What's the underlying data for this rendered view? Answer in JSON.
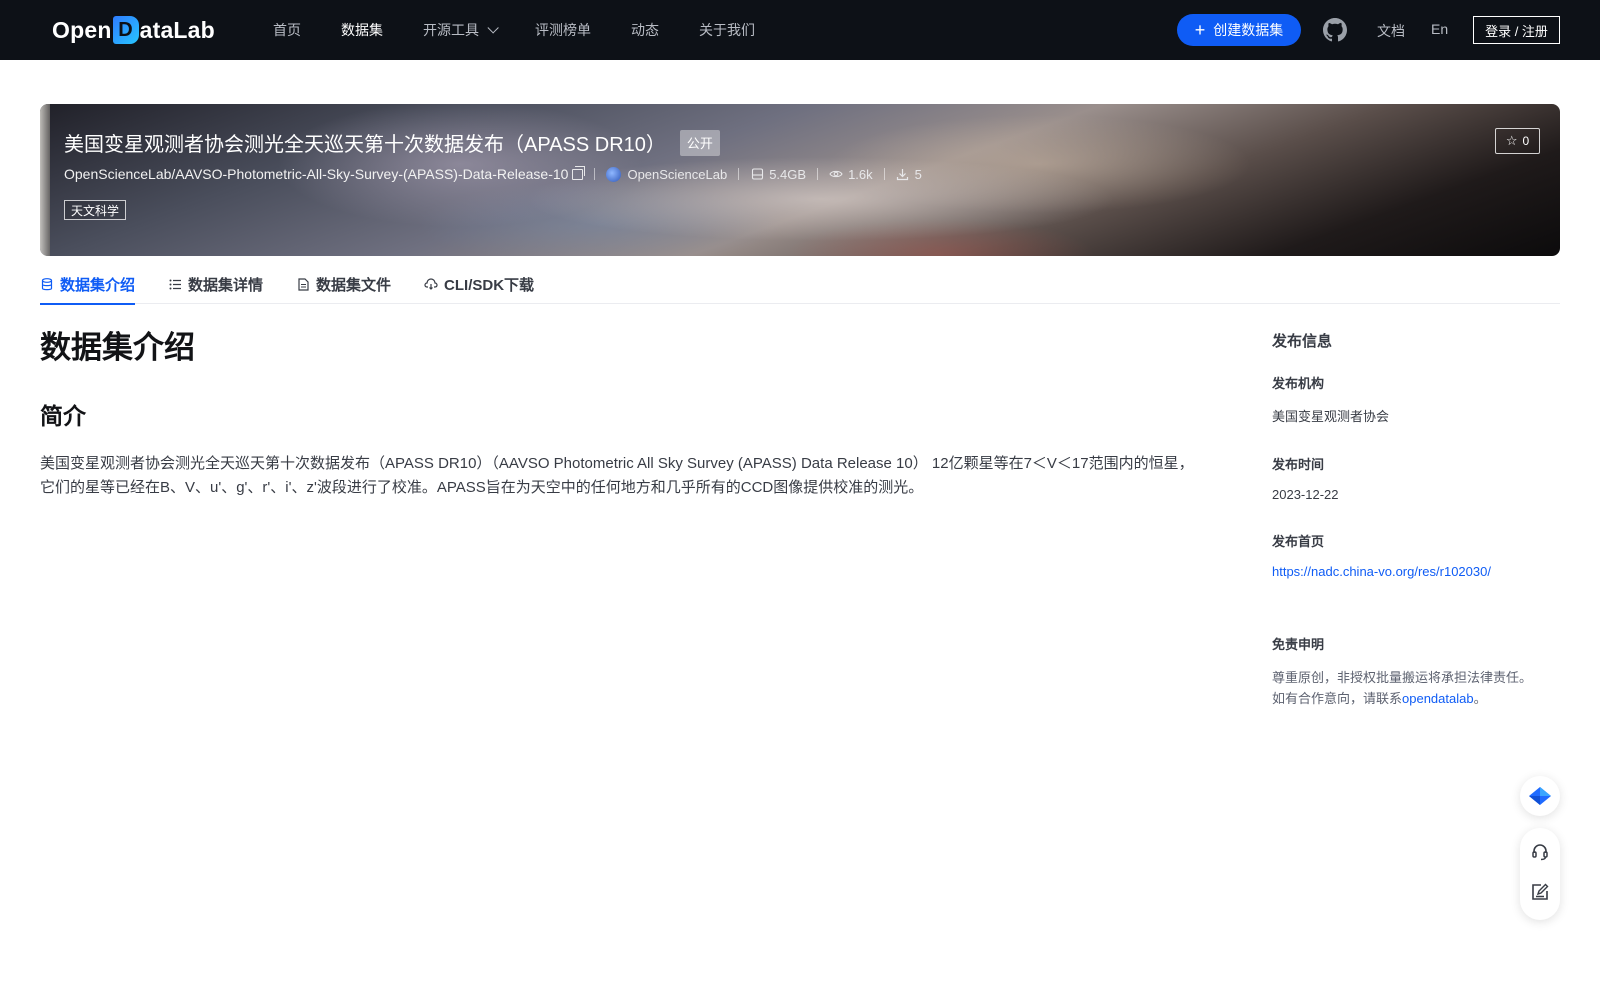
{
  "nav": {
    "logo_before": "Open",
    "logo_d": "D",
    "logo_after": "ataLab",
    "links": [
      "首页",
      "数据集",
      "开源工具",
      "评测榜单",
      "动态",
      "关于我们"
    ],
    "create_label": "创建数据集",
    "docs_label": "文档",
    "lang_label": "En",
    "login_label": "登录 / 注册"
  },
  "dataset": {
    "title": "美国变星观测者协会测光全天巡天第十次数据发布（APASS DR10）",
    "visibility": "公开",
    "slug": "OpenScienceLab/AAVSO-Photometric-All-Sky-Survey-(APASS)-Data-Release-10",
    "org": "OpenScienceLab",
    "size": "5.4GB",
    "views": "1.6k",
    "downloads": "5",
    "tag": "天文科学",
    "stars": "0"
  },
  "tabs": [
    "数据集介绍",
    "数据集详情",
    "数据集文件",
    "CLI/SDK下载"
  ],
  "content": {
    "heading": "数据集介绍",
    "section": "简介",
    "paragraph": "美国变星观测者协会测光全天巡天第十次数据发布（APASS DR10）（AAVSO Photometric All Sky Survey (APASS) Data Release 10） 12亿颗星等在7＜V＜17范围内的恒星，它们的星等已经在B、V、u'、g'、r'、i'、z'波段进行了校准。APASS旨在为天空中的任何地方和几乎所有的CCD图像提供校准的测光。"
  },
  "sidebar": {
    "title": "发布信息",
    "org_label": "发布机构",
    "org_value": "美国变星观测者协会",
    "time_label": "发布时间",
    "time_value": "2023-12-22",
    "home_label": "发布首页",
    "home_value": "https://nadc.china-vo.org/res/r102030/",
    "disclaimer_label": "免责申明",
    "disclaimer_line1": "尊重原创，非授权批量搬运将承担法律责任。",
    "disclaimer_line2_prefix": "如有合作意向，请联系",
    "disclaimer_link": "opendatalab",
    "disclaimer_line2_suffix": "。"
  },
  "colors": {
    "nav_bg": "#0d1117",
    "accent": "#0f5cf5"
  }
}
